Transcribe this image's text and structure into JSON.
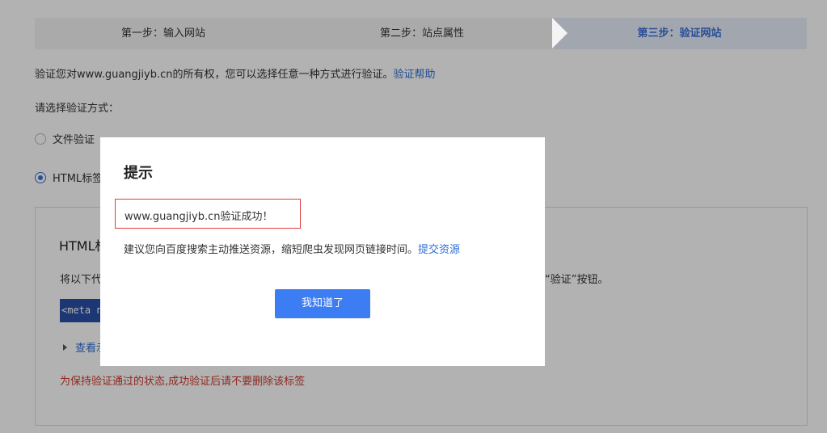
{
  "steps": [
    {
      "label": "第一步：输入网站"
    },
    {
      "label": "第二步：站点属性"
    },
    {
      "label": "第三步：验证网站"
    }
  ],
  "intro": {
    "text": "验证您对www.guangjiyb.cn的所有权，您可以选择任意一种方式进行验证。",
    "help_link": "验证帮助"
  },
  "choose_label": "请选择验证方式：",
  "methods": [
    {
      "label": "文件验证",
      "checked": false
    },
    {
      "label": "HTML标签",
      "checked": true
    }
  ],
  "panel": {
    "title": "HTML标",
    "desc_left": "将以下代",
    "desc_right": "“验证”按钮。",
    "code": "<meta n",
    "view_link": "查看示",
    "warning": "为保持验证通过的状态,成功验证后请不要删除该标签"
  },
  "modal": {
    "title": "提示",
    "success_text": "www.guangjiyb.cn验证成功！",
    "suggest_text": "建议您向百度搜索主动推送资源，缩短爬虫发现网页链接时间。",
    "submit_link": "提交资源",
    "ok_label": "我知道了"
  },
  "colors": {
    "accent": "#3a6fd8",
    "button": "#3d7df3",
    "warning": "#d0392b",
    "error_border": "#e03a3a"
  }
}
